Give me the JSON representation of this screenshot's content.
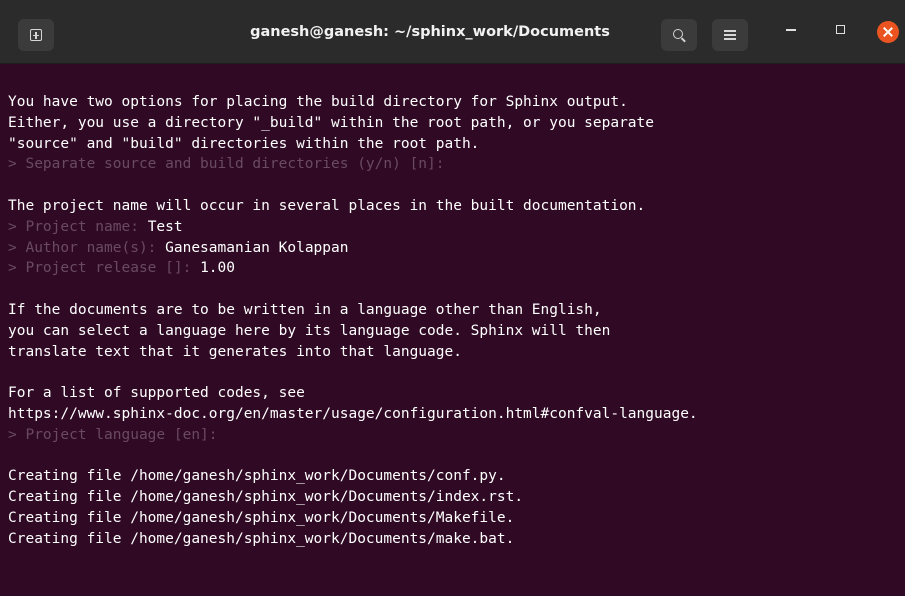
{
  "window": {
    "title": "ganesh@ganesh: ~/sphinx_work/Documents"
  },
  "titlebar": {
    "icons": {
      "new_tab": "new-tab-icon",
      "search": "search-icon",
      "menu": "hamburger-menu-icon",
      "minimize": "minimize-icon",
      "maximize": "maximize-icon",
      "close": "close-icon"
    },
    "colors": {
      "close_button": "#e95420",
      "titlebar_bg": "#2b2b2b",
      "terminal_bg": "#300a24"
    }
  },
  "terminal": {
    "lines": [
      {
        "text": "You have two options for placing the build directory for Sphinx output."
      },
      {
        "text": "Either, you use a directory \"_build\" within the root path, or you separate"
      },
      {
        "text": "\"source\" and \"build\" directories within the root path."
      },
      {
        "prompt": "> Separate source and build directories (y/n) [n]: ",
        "answer": ""
      },
      {
        "text": ""
      },
      {
        "text": "The project name will occur in several places in the built documentation."
      },
      {
        "prompt": "> Project name: ",
        "answer": "Test"
      },
      {
        "prompt": "> Author name(s): ",
        "answer": "Ganesamanian Kolappan"
      },
      {
        "prompt": "> Project release []: ",
        "answer": "1.00"
      },
      {
        "text": ""
      },
      {
        "text": "If the documents are to be written in a language other than English,"
      },
      {
        "text": "you can select a language here by its language code. Sphinx will then"
      },
      {
        "text": "translate text that it generates into that language."
      },
      {
        "text": ""
      },
      {
        "text": "For a list of supported codes, see"
      },
      {
        "text": "https://www.sphinx-doc.org/en/master/usage/configuration.html#confval-language."
      },
      {
        "prompt": "> Project language [en]: ",
        "answer": ""
      },
      {
        "text": ""
      },
      {
        "text": "Creating file /home/ganesh/sphinx_work/Documents/conf.py."
      },
      {
        "text": "Creating file /home/ganesh/sphinx_work/Documents/index.rst."
      },
      {
        "text": "Creating file /home/ganesh/sphinx_work/Documents/Makefile."
      },
      {
        "text": "Creating file /home/ganesh/sphinx_work/Documents/make.bat."
      }
    ]
  }
}
